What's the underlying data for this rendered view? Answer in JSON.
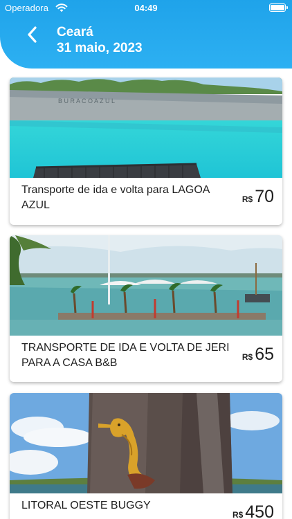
{
  "status": {
    "carrier": "Operadora",
    "time": "04:49"
  },
  "header": {
    "title": "Ceará",
    "date": "31 maio, 2023",
    "back_icon": "chevron-left-icon"
  },
  "colors": {
    "header": "#23a8ee",
    "text": "#1f1f1f"
  },
  "cards": [
    {
      "title": "Transporte de ida e volta para LAGOA AZUL",
      "currency": "R$",
      "price": "70"
    },
    {
      "title": "TRANSPORTE DE IDA E VOLTA DE JERI PARA A CASA B&B",
      "currency": "R$",
      "price": "65"
    },
    {
      "title": "LITORAL OESTE BUGGY",
      "currency": "R$",
      "price": "450"
    }
  ]
}
